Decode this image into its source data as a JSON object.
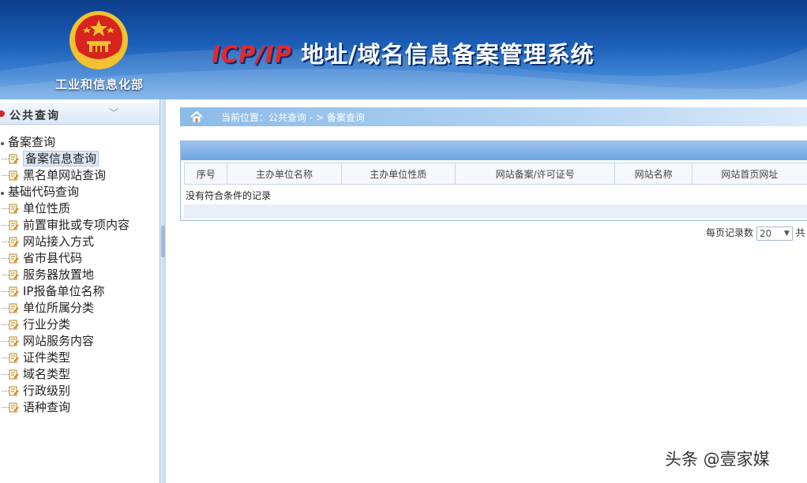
{
  "header": {
    "ministry": "工业和信息化部",
    "title_latin": "ICP/IP",
    "title_cn": " 地址/域名信息备案管理系统"
  },
  "sidebar": {
    "section_title": "公共查询",
    "chevron": "﹀",
    "tree": [
      {
        "label": "备案查询",
        "type": "group"
      },
      {
        "label": "备案信息查询",
        "type": "leaf",
        "selected": true
      },
      {
        "label": "黑名单网站查询",
        "type": "leaf"
      },
      {
        "label": "基础代码查询",
        "type": "group"
      },
      {
        "label": "单位性质",
        "type": "leaf"
      },
      {
        "label": "前置审批或专项内容",
        "type": "leaf"
      },
      {
        "label": "网站接入方式",
        "type": "leaf"
      },
      {
        "label": "省市县代码",
        "type": "leaf"
      },
      {
        "label": "服务器放置地",
        "type": "leaf"
      },
      {
        "label": "IP报备单位名称",
        "type": "leaf"
      },
      {
        "label": "单位所属分类",
        "type": "leaf"
      },
      {
        "label": "行业分类",
        "type": "leaf"
      },
      {
        "label": "网站服务内容",
        "type": "leaf"
      },
      {
        "label": "证件类型",
        "type": "leaf"
      },
      {
        "label": "域名类型",
        "type": "leaf"
      },
      {
        "label": "行政级别",
        "type": "leaf"
      },
      {
        "label": "语种查询",
        "type": "leaf"
      }
    ]
  },
  "breadcrumb": {
    "text": "当前位置：公共查询  - >  备案查询"
  },
  "table": {
    "columns": [
      "序号",
      "主办单位名称",
      "主办单位性质",
      "网站备案/许可证号",
      "网站名称",
      "网站首页网址"
    ],
    "empty_message": "没有符合条件的记录"
  },
  "pager": {
    "per_page_label": "每页记录数",
    "per_page_value": "20",
    "total_prefix": "共 ("
  },
  "watermark": "头条 @壹家媒",
  "colors": {
    "header_blue": "#1c5fb8",
    "title_red": "#e8262b",
    "emblem_red": "#d8231f",
    "emblem_gold": "#f2c230"
  }
}
